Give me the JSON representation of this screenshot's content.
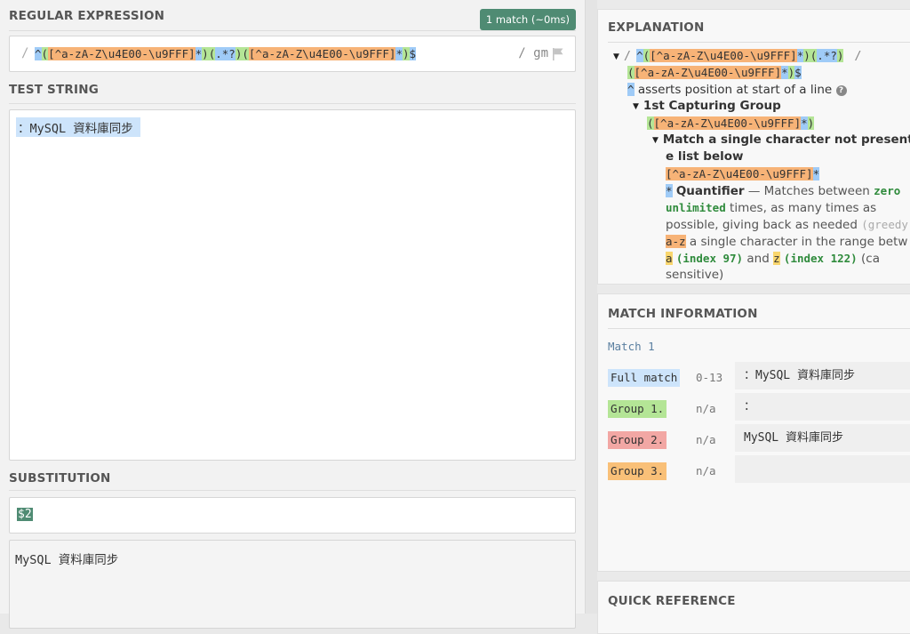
{
  "regex": {
    "title": "REGULAR EXPRESSION",
    "match_badge": "1 match (~0ms)",
    "slash_open": "/",
    "flags": "/ gm",
    "pattern_parts": {
      "caret": "^",
      "g1_open": "(",
      "cls1": "[^a-zA-Z\\u4E00-\\u9FFF]",
      "star1": "*",
      "g1_close": ")",
      "g2_open": "(",
      "dot": ".",
      "lazy": "*?",
      "g2_close": ")",
      "g3_open": "(",
      "cls2": "[^a-zA-Z\\u4E00-\\u9FFF]",
      "star2": "*",
      "g3_close": ")",
      "dollar": "$"
    }
  },
  "test_string": {
    "title": "TEST STRING",
    "value": "：MySQL 資料庫同步"
  },
  "substitution": {
    "title": "SUBSTITUTION",
    "value": "$2",
    "result": "MySQL 資料庫同步"
  },
  "explanation": {
    "title": "EXPLANATION",
    "line1_slash": "/",
    "line1_pattern": "^([^a-zA-Z\\u4E00-\\u9FFF]*)(.*?)",
    "line1_slash2": "/",
    "line2_pattern": "([^a-zA-Z\\u4E00-\\u9FFF]*)$",
    "caret_token": "^",
    "caret_desc": "asserts position at start of a line",
    "help": "?",
    "group1_title": "1st Capturing Group",
    "group1_token": "([^a-zA-Z\\u4E00-\\u9FFF]*)",
    "match_title_a": "Match a single character not present",
    "match_title_b": "e list below",
    "class_token": "[^a-zA-Z\\u4E00-\\u9FFF]",
    "class_star": "*",
    "quant_star": "*",
    "quant_label": "Quantifier",
    "quant_dash": "— Matches between",
    "quant_zero": "zero",
    "quant_unlimited": "unlimited",
    "quant_mid": "times, as many times as",
    "quant_line3": "possible, giving back as needed",
    "quant_greedy": "(greedy",
    "az_token": "a-z",
    "az_desc": "a single character in the range betw",
    "a_token": "a",
    "a_index": "(index 97)",
    "and_word": "and",
    "z_token": "z",
    "z_index": "(index 122)",
    "case_tail": "(ca",
    "sensitive": "sensitive)"
  },
  "match_info": {
    "title": "MATCH INFORMATION",
    "match_label": "Match 1",
    "rows": [
      {
        "tag": "Full match",
        "range": "0-13",
        "value": "：MySQL 資料庫同步",
        "color": "#cde4fb"
      },
      {
        "tag": "Group 1.",
        "range": "n/a",
        "value": "：",
        "color": "#b4e596"
      },
      {
        "tag": "Group 2.",
        "range": "n/a",
        "value": "MySQL 資料庫同步",
        "color": "#f2a7a4"
      },
      {
        "tag": "Group 3.",
        "range": "n/a",
        "value": "",
        "color": "#f9c078"
      }
    ]
  },
  "quick_ref": {
    "title": "QUICK REFERENCE"
  },
  "icons": {
    "flag": "flag-icon",
    "help": "help-icon",
    "expand": "triangle-down-icon"
  }
}
